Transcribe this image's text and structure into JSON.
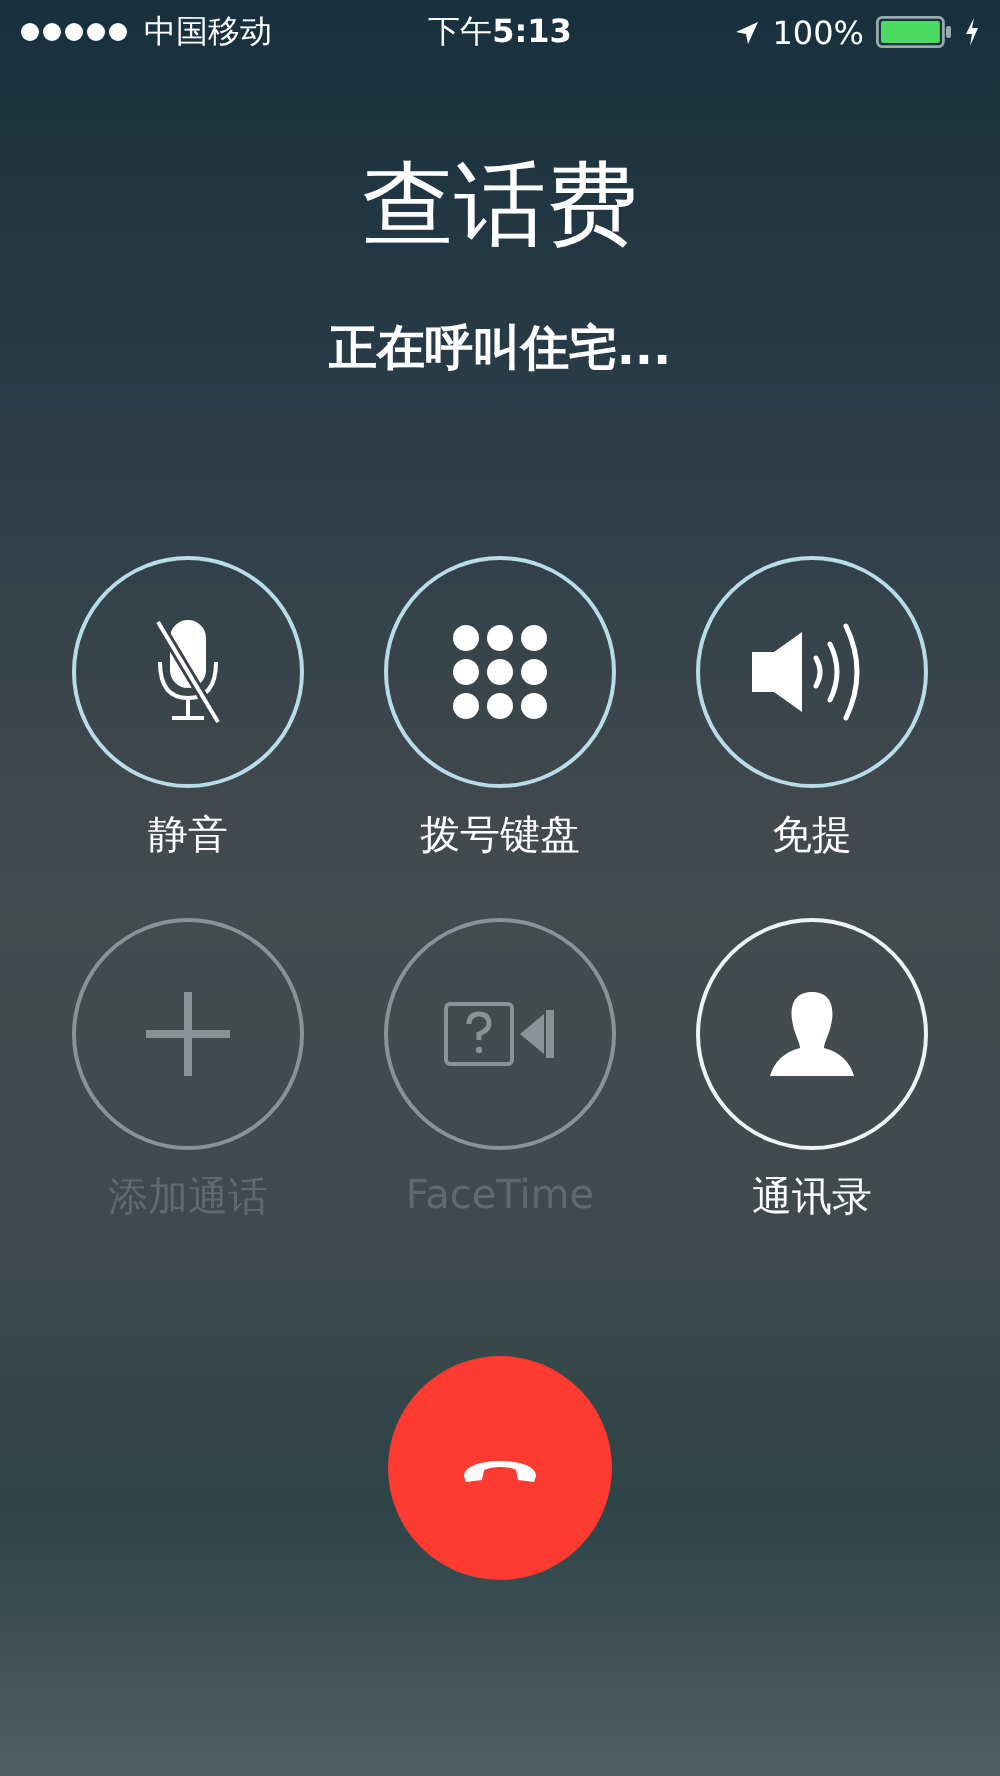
{
  "status_bar": {
    "carrier": "中国移动",
    "time": "下午**5:13**",
    "battery": "100%"
  },
  "call": {
    "name": "查话费",
    "status": "正在呼叫住宅..."
  },
  "buttons": [
    {
      "kind": "mute",
      "label": "静音",
      "disabled": false
    },
    {
      "kind": "keypad",
      "label": "拨号键盘",
      "disabled": false
    },
    {
      "kind": "speaker",
      "label": "免提",
      "disabled": false
    },
    {
      "kind": "add",
      "label": "添加通话",
      "disabled": true
    },
    {
      "kind": "facetime",
      "label": "FaceTime",
      "disabled": true
    },
    {
      "kind": "contacts",
      "label": "通讯录",
      "disabled": false
    }
  ]
}
